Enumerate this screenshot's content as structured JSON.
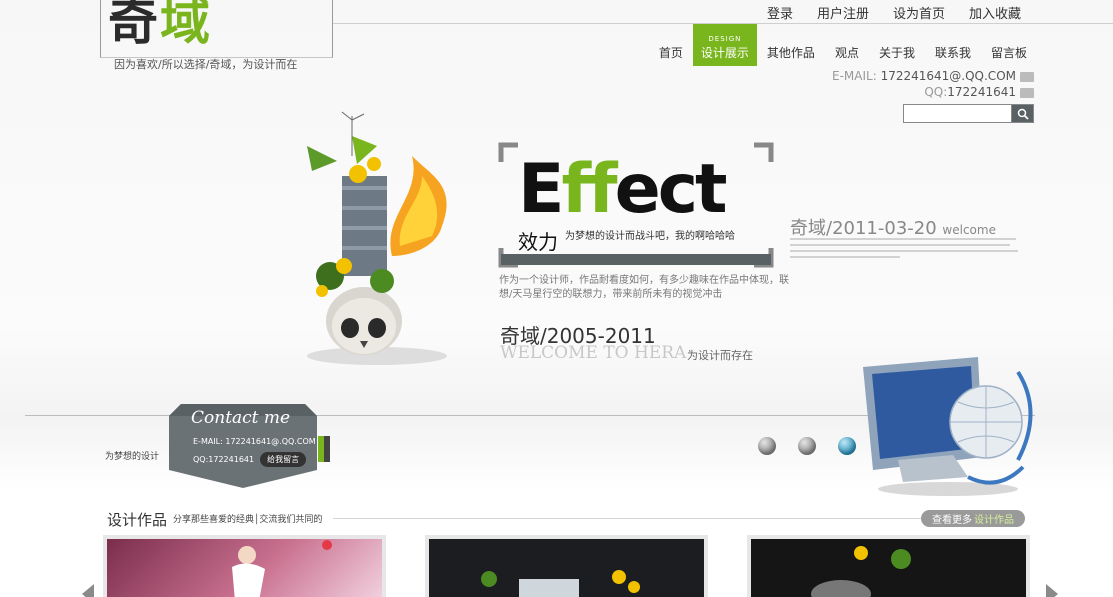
{
  "header": {
    "logo": {
      "char1": "奇",
      "char2": "域"
    },
    "slogan": "因为喜欢/所以选择/奇域，为设计而在",
    "top_links": [
      "登录",
      "用户注册",
      "设为首页",
      "加入收藏"
    ]
  },
  "nav": {
    "items": [
      {
        "label": "首页"
      },
      {
        "label": "设计展示",
        "small": "DESIGN",
        "active": true
      },
      {
        "label": "其他作品"
      },
      {
        "label": "观点"
      },
      {
        "label": "关于我"
      },
      {
        "label": "联系我"
      },
      {
        "label": "留言板"
      }
    ]
  },
  "contact": {
    "email_label": "E-MAIL:",
    "email": "172241641@.QQ.COM",
    "qq_label": "QQ:",
    "qq": "172241641"
  },
  "search": {
    "value": "",
    "placeholder": ""
  },
  "hero": {
    "effect_word_1": "E",
    "effect_word_2": "ff",
    "effect_word_3": "ect",
    "effect_cn": "效力",
    "effect_tag": "为梦想的设计而战斗吧，我的啊哈哈哈",
    "paragraph": "作为一个设计师，作品耐看度如何，有多少趣味在作品中体现，联想/天马星行空的联想力，带来前所未有的视觉冲击",
    "year_title": "奇域/2005-2011",
    "welcome": "WELCOME TO HERA",
    "welcome_tag": "为设计而存在",
    "date_head": "奇域/2011-03-20",
    "date_welcome": "welcome"
  },
  "band": {
    "dream": "为梦想的设计",
    "contact_title": "Contact me",
    "card_email": "E-MAIL: 172241641@.QQ.COM",
    "card_qq": "QQ:172241641",
    "card_button": "给我留言"
  },
  "works": {
    "title": "设计作品",
    "subtitle": "分享那些喜爱的经典│交流我们共同的",
    "more_prefix": "查看更多",
    "more_suffix": "设计作品"
  },
  "colors": {
    "accent": "#79b51c",
    "dark": "#5a6165"
  }
}
